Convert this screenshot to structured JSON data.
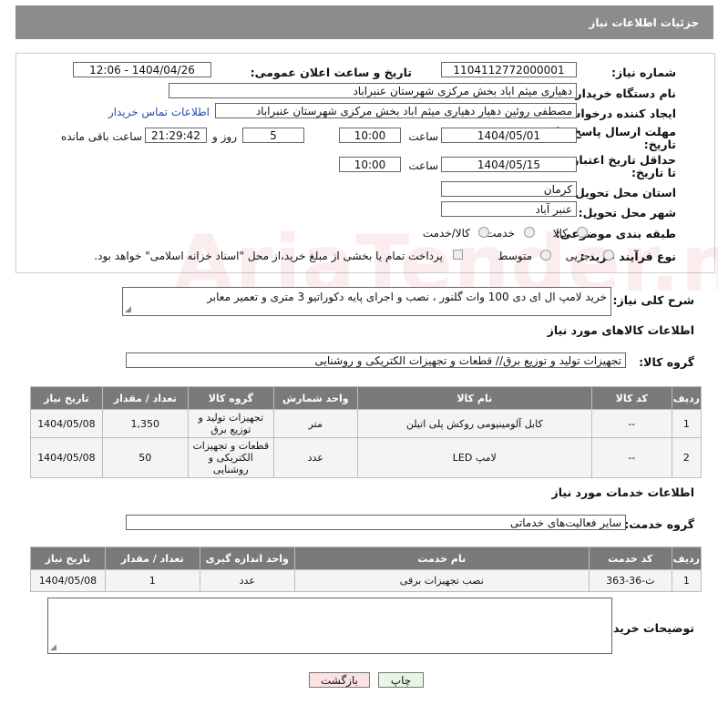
{
  "header": {
    "title": "جزئیات اطلاعات نیاز"
  },
  "fields": {
    "need_number_label": "شماره نیاز:",
    "need_number": "1104112772000001",
    "announce_label": "تاریخ و ساعت اعلان عمومی:",
    "announce_value": "1404/04/26 - 12:06",
    "buyer_org_label": "نام دستگاه خریدار:",
    "buyer_org": "دهیاری میثم اباد بخش مرکزی شهرستان عنبراباد",
    "creator_label": "ایجاد کننده درخواست:",
    "creator": "مصطفی روئین دهیار دهیاری میثم اباد بخش مرکزی شهرستان عنبراباد",
    "contact_link": "اطلاعات تماس خریدار",
    "deadline_label_1": "مهلت ارسال پاسخ: تا",
    "deadline_label_2": "تاریخ:",
    "deadline_date": "1404/05/01",
    "time_label": "ساعت",
    "deadline_time": "10:00",
    "days_value": "5",
    "days_label": "روز و",
    "remaining_time": "21:29:42",
    "remaining_label": "ساعت باقی مانده",
    "price_valid_label_1": "حداقل تاریخ اعتبار قیمت:",
    "price_valid_label_2": "تا تاریخ:",
    "price_valid_date": "1404/05/15",
    "price_valid_time": "10:00",
    "province_label": "استان محل تحویل:",
    "province": "کرمان",
    "city_label": "شهر محل تحویل:",
    "city": "عنبر آباد",
    "category_label": "طبقه بندی موضوعی:",
    "category_options": [
      "کالا",
      "خدمت",
      "کالا/خدمت"
    ],
    "purchase_type_label": "نوع فرآیند خرید :",
    "purchase_options": [
      "جزیی",
      "متوسط"
    ],
    "payment_note": "پرداخت تمام یا بخشی از مبلغ خرید،از محل \"اسناد خزانه اسلامی\" خواهد بود."
  },
  "description": {
    "label": "شرح کلی نیاز:",
    "text": "خرید لامپ   ال ای دی 100 وات گلنور ، نصب و اجرای پایه دکوراتیو 3 متری و تعمیر معابر"
  },
  "goods": {
    "section_title": "اطلاعات کالاهای مورد نیاز",
    "group_label": "گروه کالا:",
    "group_value": "تجهیزات تولید و توزیع برق// قطعات و تجهیزات الکتریکی و روشنایی",
    "columns": [
      "ردیف",
      "کد کالا",
      "نام کالا",
      "واحد شمارش",
      "گروه کالا",
      "تعداد / مقدار",
      "تاریخ نیاز"
    ],
    "rows": [
      [
        "1",
        "--",
        "کابل آلومینیومی روکش پلی اتیلن",
        "متر",
        "تجهیزات تولید و توزیع برق",
        "1,350",
        "1404/05/08"
      ],
      [
        "2",
        "--",
        "لامپ LED",
        "عدد",
        "قطعات و تجهیزات الکتریکی و روشنایی",
        "50",
        "1404/05/08"
      ]
    ]
  },
  "services": {
    "section_title": "اطلاعات خدمات مورد نیاز",
    "group_label": "گروه خدمت:",
    "group_value": "سایر فعالیت‌های خدماتی",
    "columns": [
      "ردیف",
      "کد خدمت",
      "نام خدمت",
      "واحد اندازه گیری",
      "تعداد / مقدار",
      "تاریخ نیاز"
    ],
    "rows": [
      [
        "1",
        "ث-36-363",
        "نصب تجهیزات برقی",
        "عدد",
        "1",
        "1404/05/08"
      ]
    ]
  },
  "buyer_notes": {
    "label": "توضیحات خریدار:",
    "text": ""
  },
  "buttons": {
    "print": "چاپ",
    "back": "بازگشت"
  },
  "watermark": {
    "text": "AriaTender.neT"
  },
  "colors": {
    "header_bg": "#8c8c8c",
    "table_header_bg": "#7a7a7a",
    "print_bg": "#e6f5e6",
    "back_bg": "#fbe3e3",
    "link": "#1f4fa8"
  }
}
